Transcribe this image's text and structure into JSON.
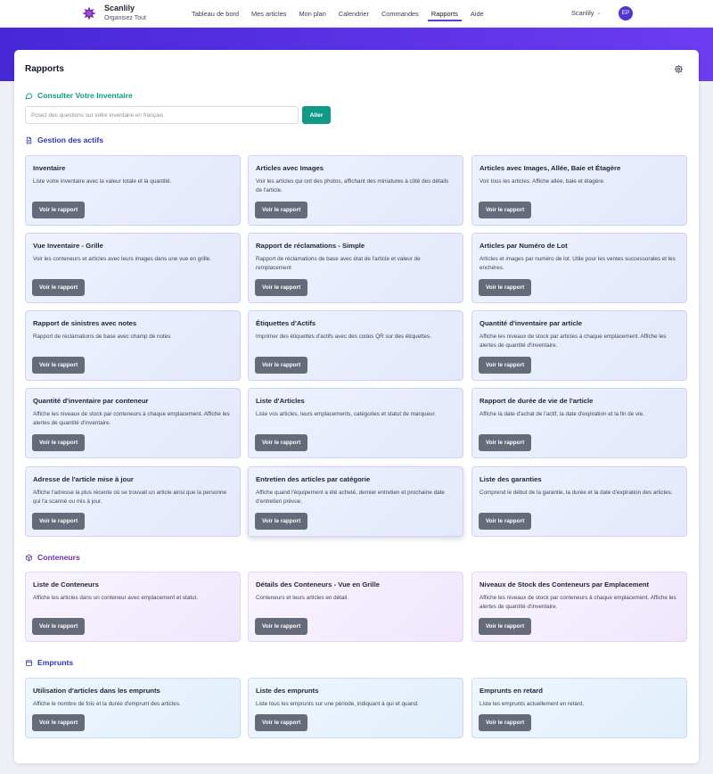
{
  "header": {
    "brand_name": "Scanlily",
    "brand_tagline": "Organisez Tout",
    "nav": [
      {
        "label": "Tableau de bord",
        "active": false
      },
      {
        "label": "Mes articles",
        "active": false
      },
      {
        "label": "Mon plan",
        "active": false
      },
      {
        "label": "Calendrier",
        "active": false
      },
      {
        "label": "Commandes",
        "active": false
      },
      {
        "label": "Rapports",
        "active": true
      },
      {
        "label": "Aide",
        "active": false
      }
    ],
    "user_menu_label": "Scanlily",
    "avatar_initials": "EP"
  },
  "page": {
    "title": "Rapports"
  },
  "query": {
    "heading": "Consulter Votre Inventaire",
    "placeholder": "Posez des questions sur votre inventaire en français",
    "value": "",
    "button_label": "Aller"
  },
  "button_label": "Voir le rapport",
  "colors": {
    "accent": "#4f35d6",
    "teal": "#0f9a87",
    "section_blue": "#2d37a8",
    "section_purple": "#6b2fa8"
  },
  "sections": [
    {
      "title": "Gestion des actifs",
      "icon": "document-icon",
      "color": "#2d37a8",
      "cards": [
        {
          "title": "Inventaire",
          "description": "Liste votre inventaire avec la valeur totale et la quantité."
        },
        {
          "title": "Articles avec Images",
          "description": "Voir les articles qui ont des photos, affichant des miniatures à côté des détails de l'article."
        },
        {
          "title": "Articles avec Images, Allée, Baie et Étagère",
          "description": "Voir tous les articles. Affiche allée, baie et étagère."
        },
        {
          "title": "Vue Inventaire - Grille",
          "description": "Voir les conteneurs et articles avec leurs images dans une vue en grille."
        },
        {
          "title": "Rapport de réclamations - Simple",
          "description": "Rapport de réclamations de base avec état de l'article et valeur de remplacement"
        },
        {
          "title": "Articles par Numéro de Lot",
          "description": "Articles et images par numéro de lot. Utile pour les ventes successorales et les enchères."
        },
        {
          "title": "Rapport de sinistres avec notes",
          "description": "Rapport de réclamations de base avec champ de notes"
        },
        {
          "title": "Étiquettes d'Actifs",
          "description": "Imprimer des étiquettes d'actifs avec des codes QR sur des étiquettes."
        },
        {
          "title": "Quantité d'inventaire par article",
          "description": "Affiche les niveaux de stock par articles à chaque emplacement. Affiche les alertes de quantité d'inventaire."
        },
        {
          "title": "Quantité d'inventaire par conteneur",
          "description": "Affiche les niveaux de stock par conteneurs à chaque emplacement. Affiche les alertes de quantité d'inventaire."
        },
        {
          "title": "Liste d'Articles",
          "description": "Liste vos articles, leurs emplacements, catégories et statut de marqueur."
        },
        {
          "title": "Rapport de durée de vie de l'article",
          "description": "Affiche la date d'achat de l'actif, la date d'expiration et la fin de vie."
        },
        {
          "title": "Adresse de l'article mise à jour",
          "description": "Affiche l'adresse la plus récente où se trouvait un article ainsi que la personne qui l'a scanné ou mis à jour."
        },
        {
          "title": "Entretien des articles par catégorie",
          "description": "Affiche quand l'équipement a été acheté, dernier entretien et prochaine date d'entretien prévue."
        },
        {
          "title": "Liste des garanties",
          "description": "Comprend le début de la garantie, la durée et la date d'expiration des articles."
        }
      ]
    },
    {
      "title": "Conteneurs",
      "icon": "box-icon",
      "color": "#6b2fa8",
      "cards": [
        {
          "title": "Liste de Conteneurs",
          "description": "Affiche les articles dans un conteneur avec emplacement et statut."
        },
        {
          "title": "Détails des Conteneurs - Vue en Grille",
          "description": "Conteneurs et leurs articles en détail."
        },
        {
          "title": "Niveaux de Stock des Conteneurs par Emplacement",
          "description": "Affiche les niveaux de stock par conteneurs à chaque emplacement. Affiche les alertes de quantité d'inventaire."
        }
      ]
    },
    {
      "title": "Emprunts",
      "icon": "calendar-icon",
      "color": "#2d37a8",
      "cards": [
        {
          "title": "Utilisation d'articles dans les emprunts",
          "description": "Affiche le nombre de fois et la durée d'emprunt des articles."
        },
        {
          "title": "Liste des emprunts",
          "description": "Liste tous les emprunts sur une période, indiquant à qui et quand."
        },
        {
          "title": "Emprunts en retard",
          "description": "Liste les emprunts actuellement en retard."
        }
      ]
    }
  ]
}
